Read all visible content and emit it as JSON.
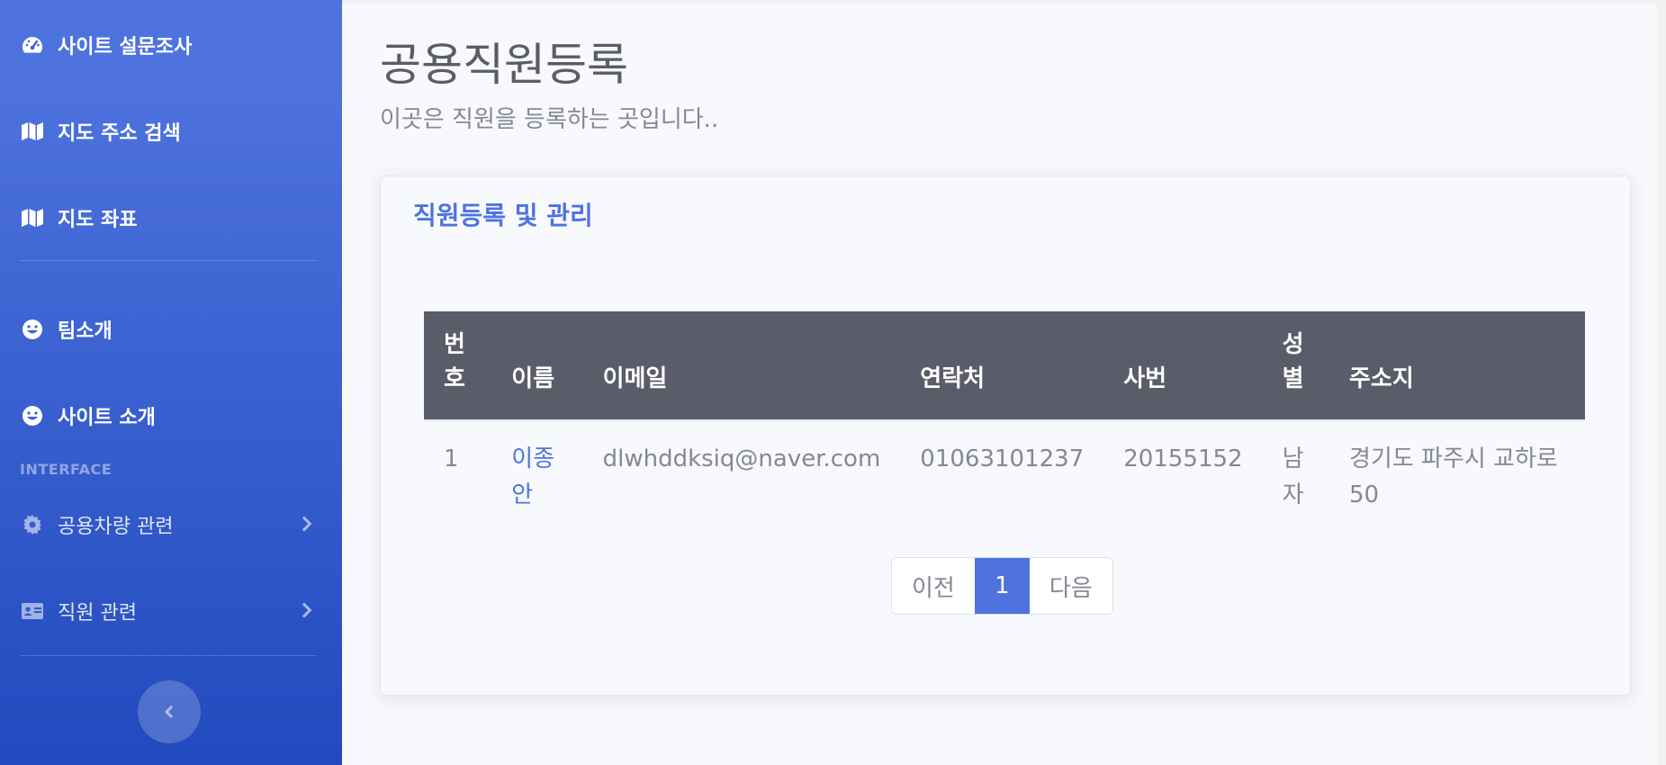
{
  "sidebar": {
    "items": [
      {
        "label": "사이트 설문조사",
        "icon": "tachometer-icon"
      },
      {
        "label": "지도 주소 검색",
        "icon": "map-icon"
      },
      {
        "label": "지도 좌표",
        "icon": "map-icon"
      },
      {
        "label": "팀소개",
        "icon": "grin-icon"
      },
      {
        "label": "사이트 소개",
        "icon": "grin-icon"
      }
    ],
    "heading": "INTERFACE",
    "collapsibles": [
      {
        "label": "공용차량 관련",
        "icon": "gear-icon"
      },
      {
        "label": "직원 관련",
        "icon": "id-card-icon"
      }
    ]
  },
  "page": {
    "title": "공용직원등록",
    "subtitle": "이곳은 직원을 등록하는 곳입니다.."
  },
  "card": {
    "title": "직원등록 및 관리",
    "table": {
      "headers": [
        "번호",
        "이름",
        "이메일",
        "연락처",
        "사번",
        "성별",
        "주소지"
      ],
      "rows": [
        [
          "1",
          "이종안",
          "dlwhddksiq@naver.com",
          "01063101237",
          "20155152",
          "남자",
          "경기도 파주시 교하로 50"
        ]
      ]
    },
    "pagination": {
      "prev": "이전",
      "current": "1",
      "next": "다음"
    }
  },
  "colors": {
    "primary": "#4e73df",
    "table_header": "#5a5c69",
    "text": "#858796"
  }
}
